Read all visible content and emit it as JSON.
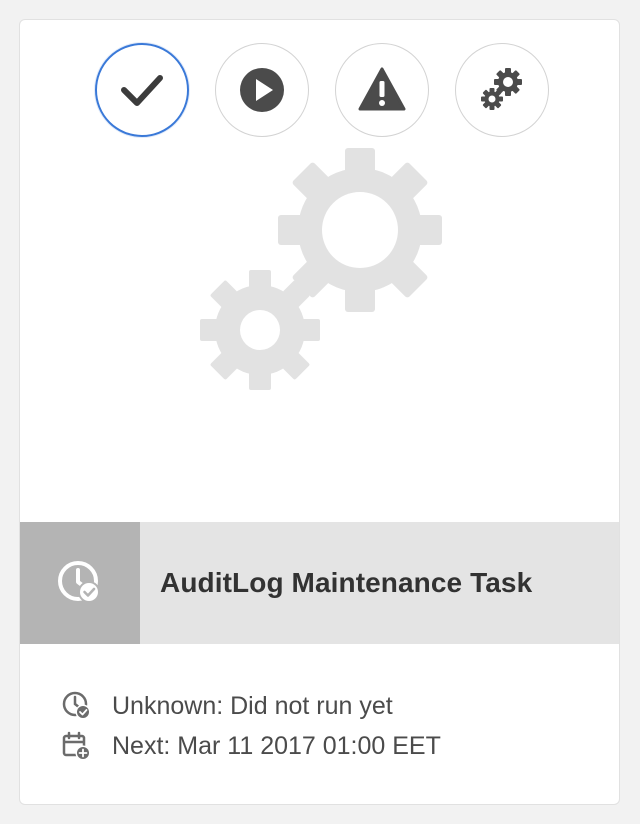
{
  "card": {
    "title": "AuditLog Maintenance Task",
    "status_text": "Unknown: Did not run yet",
    "next_text": "Next: Mar 11 2017 01:00 EET"
  },
  "quick_actions": [
    {
      "name": "select",
      "icon": "checkmark-icon",
      "selected": true
    },
    {
      "name": "run",
      "icon": "play-icon",
      "selected": false
    },
    {
      "name": "warning",
      "icon": "alert-icon",
      "selected": false
    },
    {
      "name": "configure",
      "icon": "gears-icon",
      "selected": false
    }
  ],
  "thumbnail": {
    "icon": "gears-icon"
  },
  "type_icon": "task-status-icon",
  "colors": {
    "accent": "#3a79d8",
    "icon_dark": "#4b4b4b",
    "thumbnail_gears": "#e1e1e1",
    "title_bar": "#e4e4e4",
    "type_box": "#b4b4b4"
  }
}
